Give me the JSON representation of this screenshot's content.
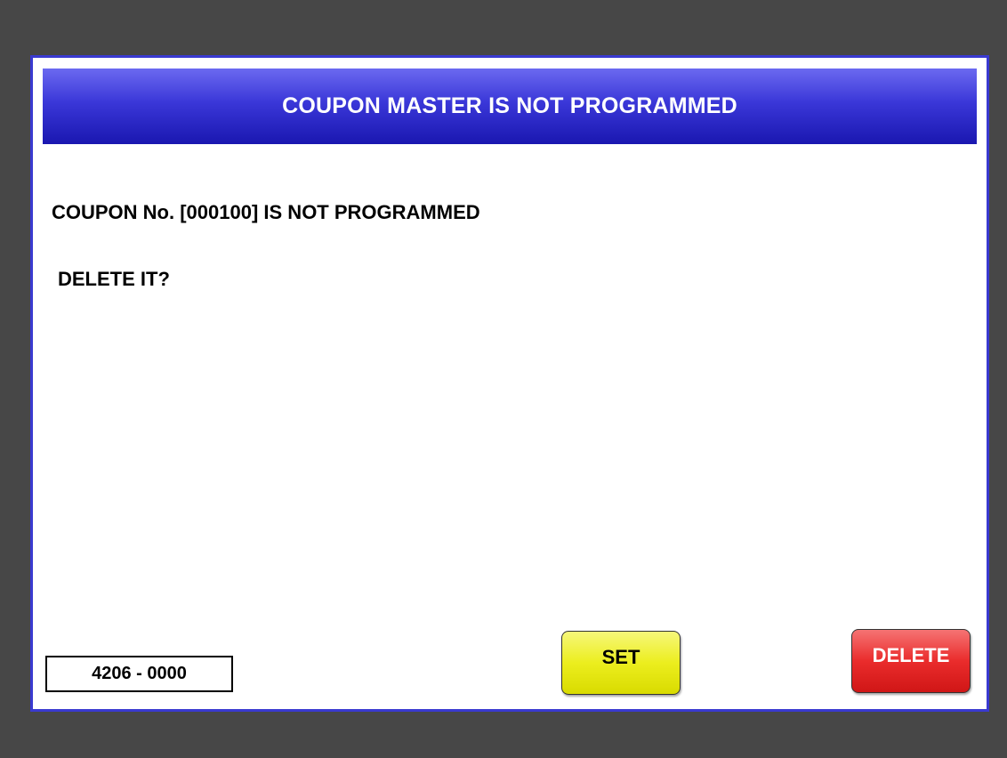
{
  "dialog": {
    "title": "COUPON MASTER IS NOT PROGRAMMED",
    "message_line1": "COUPON No. [000100] IS NOT PROGRAMMED",
    "message_line2": "DELETE IT?"
  },
  "footer": {
    "screen_code": "4206 - 0000",
    "set_label": "SET",
    "delete_label": "DELETE"
  },
  "colors": {
    "background": "#474747",
    "title_bar": "#3a37d8",
    "set_button": "#ecee1e",
    "delete_button": "#ea2c2c",
    "dialog_border": "#3a3ad0"
  }
}
